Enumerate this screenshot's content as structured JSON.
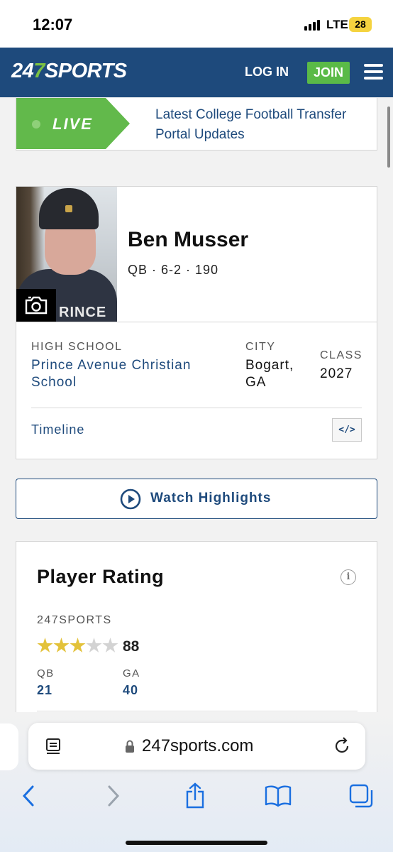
{
  "status_bar": {
    "time": "12:07",
    "network": "LTE",
    "battery": "28"
  },
  "header": {
    "logo_prefix": "24",
    "logo_seven": "7",
    "logo_suffix": "SPORTS",
    "login": "LOG IN",
    "join": "JOIN",
    "colors": {
      "brand": "#1e4a7c",
      "join": "#5aba47",
      "logo_accent": "#7bc142"
    }
  },
  "live_banner": {
    "tag": "LIVE",
    "headline": "Latest College Football Transfer Portal Updates",
    "color": "#62b94b"
  },
  "player": {
    "name": "Ben Musser",
    "position": "QB",
    "height": "6-2",
    "weight": "190",
    "meta": "QB · 6-2 · 190",
    "photo_icon": "camera-icon",
    "high_school_label": "HIGH SCHOOL",
    "high_school": "Prince Avenue Christian School",
    "city_label": "CITY",
    "city": "Bogart, GA",
    "class_label": "CLASS",
    "class": "2027",
    "timeline": "Timeline",
    "embed_icon": "</>",
    "shirt_text": "RINCE"
  },
  "highlights": {
    "label": "Watch Highlights",
    "icon": "play-circle-icon"
  },
  "rating": {
    "title": "Player Rating",
    "info_icon": "i",
    "source": "247SPORTS",
    "stars": 3,
    "max_stars": 5,
    "score": "88",
    "rank_position_label": "QB",
    "rank_position": "21",
    "rank_state_label": "GA",
    "rank_state": "40",
    "star_colors": {
      "filled": "#e3c23a",
      "empty": "#d3d3d3"
    }
  },
  "browser": {
    "url": "247sports.com",
    "icons": [
      "reader-icon",
      "lock-icon",
      "reload-icon",
      "back-icon",
      "forward-icon",
      "share-icon",
      "bookmarks-icon",
      "tabs-icon"
    ]
  }
}
